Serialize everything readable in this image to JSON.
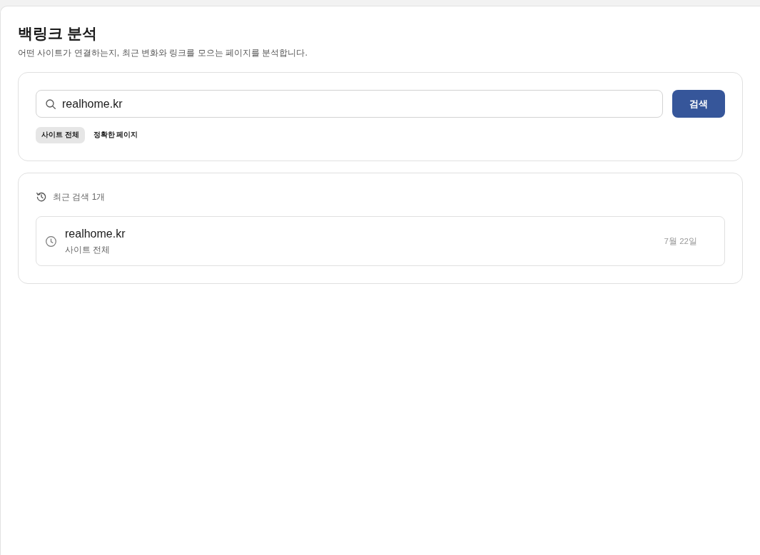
{
  "header": {
    "title": "백링크 분석",
    "subtitle": "어떤 사이트가 연결하는지, 최근 변화와 링크를 모으는 페이지를 분석합니다."
  },
  "search": {
    "value": "realhome.kr",
    "button": "검색",
    "scopes": [
      {
        "label": "사이트 전체",
        "selected": true
      },
      {
        "label": "정확한 페이지",
        "selected": false
      }
    ]
  },
  "recent": {
    "heading": "최근 검색 1개",
    "items": [
      {
        "query": "realhome.kr",
        "scope": "사이트 전체",
        "date": "7월 22일"
      }
    ]
  }
}
